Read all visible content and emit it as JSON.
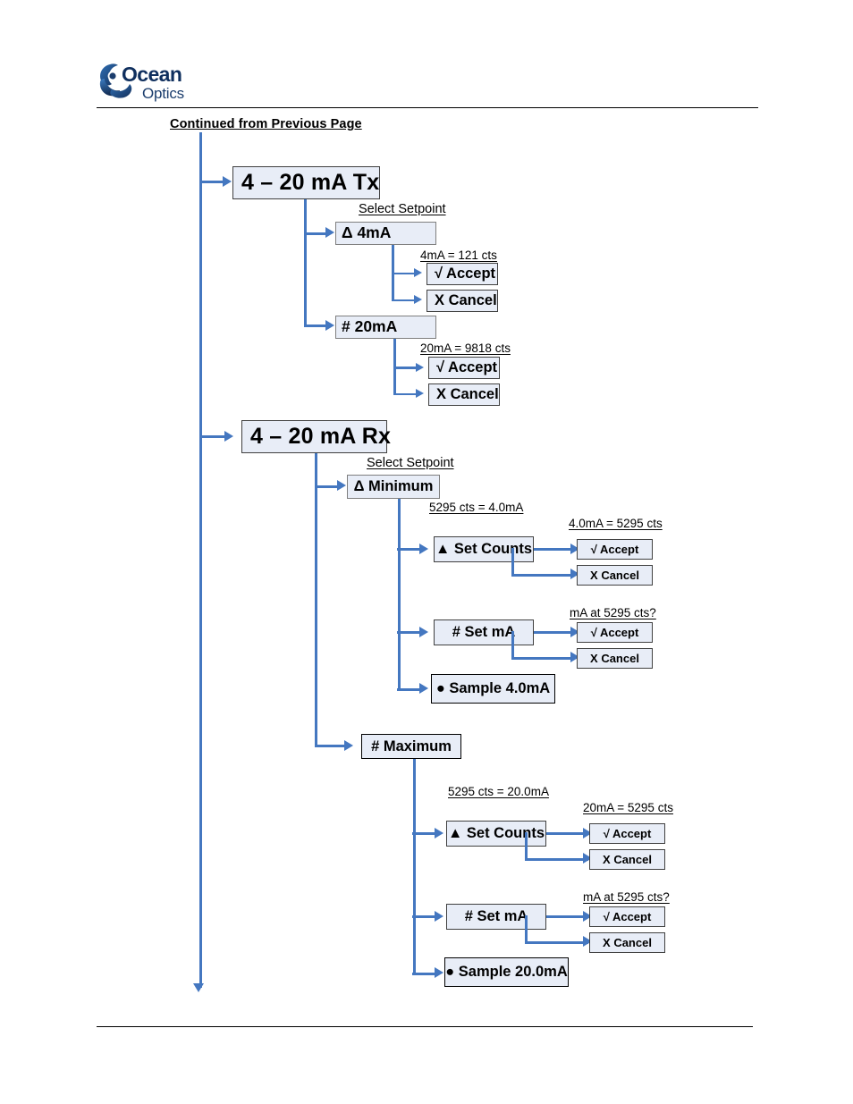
{
  "header": {
    "logo_name": "Ocean Optics",
    "logo_line1": "Ocean",
    "logo_line2": "Optics",
    "continued_note": "Continued from Previous Page"
  },
  "colors": {
    "connector": "#4477c0",
    "node_fill": "#e8edf7",
    "node_border": "#7f7f7f",
    "logo_blue": "#1b3d6d"
  },
  "diagram": {
    "tx": {
      "title": "4 – 20 mA Tx",
      "caption": "Select Setpoint",
      "branches": [
        {
          "label": "Δ 4mA",
          "caption": "4mA =    121 cts",
          "accept": "√ Accept",
          "cancel": "X Cancel"
        },
        {
          "label": "# 20mA",
          "caption": "20mA =  9818  cts",
          "accept": "√ Accept",
          "cancel": "X Cancel"
        }
      ]
    },
    "rx": {
      "title": "4 – 20 mA Rx",
      "caption": "Select Setpoint",
      "branches": [
        {
          "label": "Δ Minimum",
          "caption": "5295 cts = 4.0mA",
          "set_counts": {
            "label": "▲ Set Counts",
            "caption": "4.0mA =  5295 cts",
            "accept": "√ Accept",
            "cancel": "X Cancel"
          },
          "set_ma": {
            "label": "# Set mA",
            "caption": "mA at 5295 cts?",
            "accept": "√ Accept",
            "cancel": "X Cancel"
          },
          "sample": "● Sample 4.0mA"
        },
        {
          "label": "# Maximum",
          "caption": "5295 cts = 20.0mA",
          "set_counts": {
            "label": "▲ Set Counts",
            "caption": "20mA =  5295 cts",
            "accept": "√ Accept",
            "cancel": "X Cancel"
          },
          "set_ma": {
            "label": "# Set mA",
            "caption": "mA at 5295 cts?",
            "accept": "√ Accept",
            "cancel": "X Cancel"
          },
          "sample": "● Sample 20.0mA"
        }
      ]
    }
  }
}
